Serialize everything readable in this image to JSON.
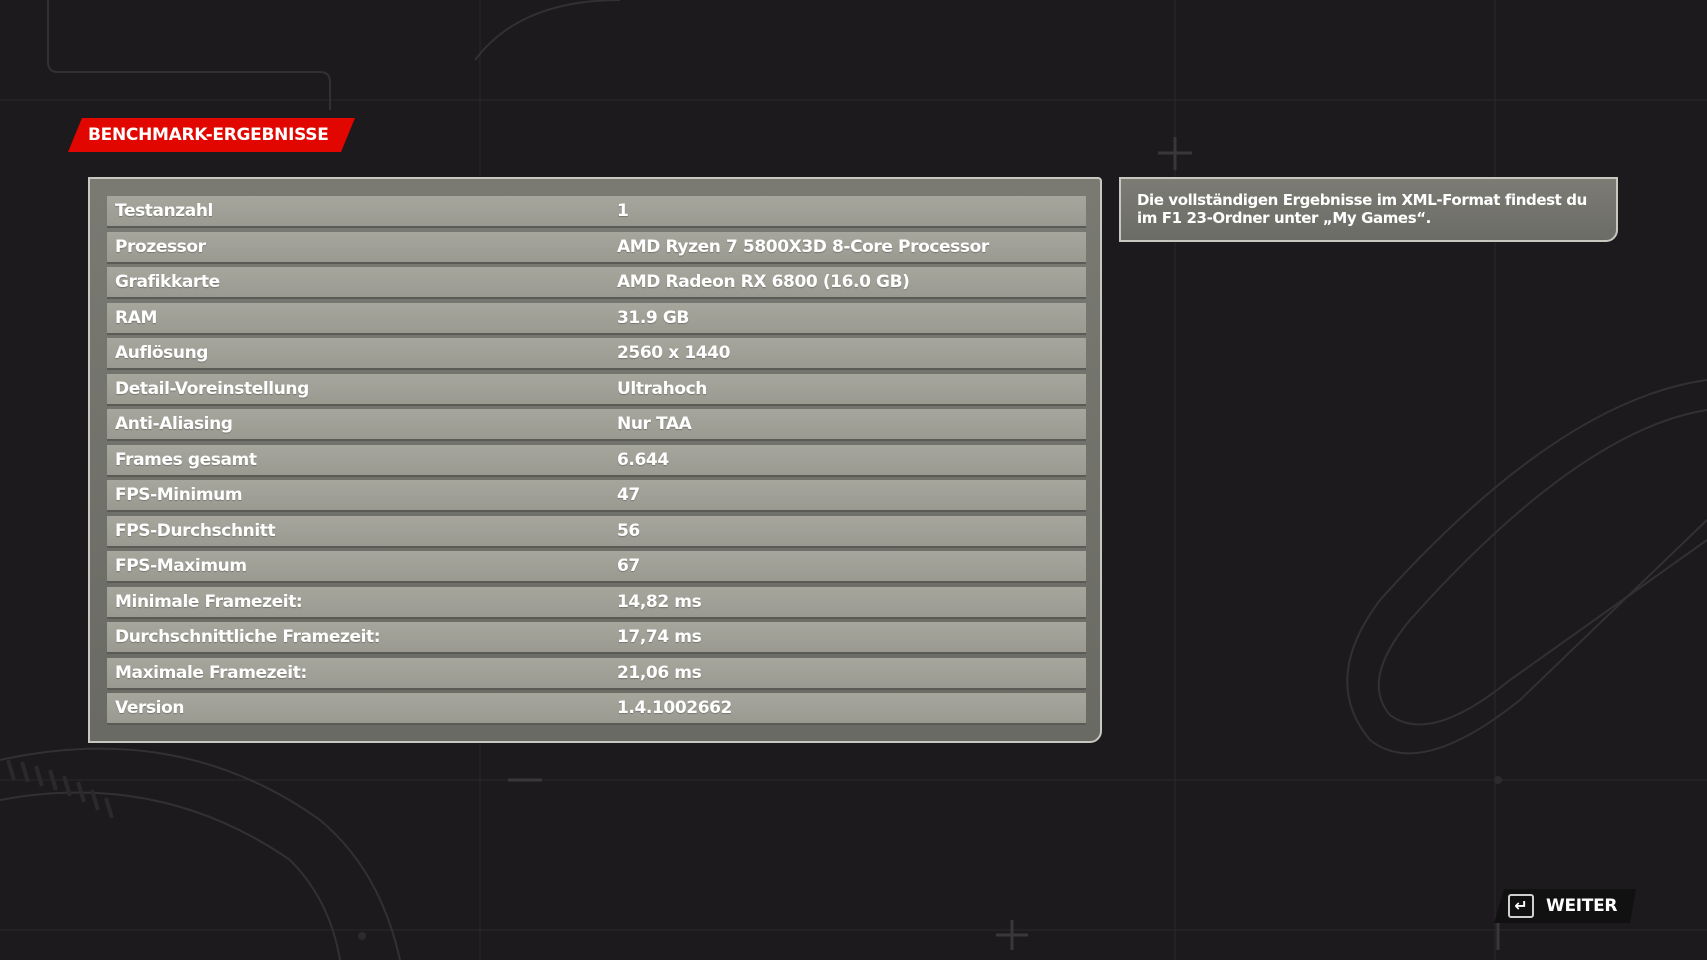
{
  "header": {
    "title": "BENCHMARK-ERGEBNISSE"
  },
  "results": [
    {
      "label": "Testanzahl",
      "value": "1"
    },
    {
      "label": "Prozessor",
      "value": "AMD Ryzen 7 5800X3D 8-Core Processor"
    },
    {
      "label": "Grafikkarte",
      "value": "AMD Radeon RX 6800 (16.0 GB)"
    },
    {
      "label": "RAM",
      "value": "31.9 GB"
    },
    {
      "label": "Auflösung",
      "value": "2560 x 1440"
    },
    {
      "label": "Detail-Voreinstellung",
      "value": "Ultrahoch"
    },
    {
      "label": "Anti-Aliasing",
      "value": "Nur TAA"
    },
    {
      "label": "Frames gesamt",
      "value": "6.644"
    },
    {
      "label": "FPS-Minimum",
      "value": "47"
    },
    {
      "label": "FPS-Durchschnitt",
      "value": "56"
    },
    {
      "label": "FPS-Maximum",
      "value": "67"
    },
    {
      "label": "Minimale Framezeit:",
      "value": "14,82 ms"
    },
    {
      "label": "Durchschnittliche Framezeit:",
      "value": "17,74 ms"
    },
    {
      "label": "Maximale Framezeit:",
      "value": "21,06 ms"
    },
    {
      "label": "Version",
      "value": "1.4.1002662"
    }
  ],
  "info": {
    "text": "Die vollständigen Ergebnisse im XML-Format findest du im F1 23-Ordner unter „My Games“."
  },
  "footer": {
    "continue_label": "WEITER",
    "continue_icon": "enter-key-icon"
  },
  "colors": {
    "accent": "#e10600",
    "background": "#1c1a1c",
    "row": "#a3a39a",
    "panel": "#737370"
  }
}
